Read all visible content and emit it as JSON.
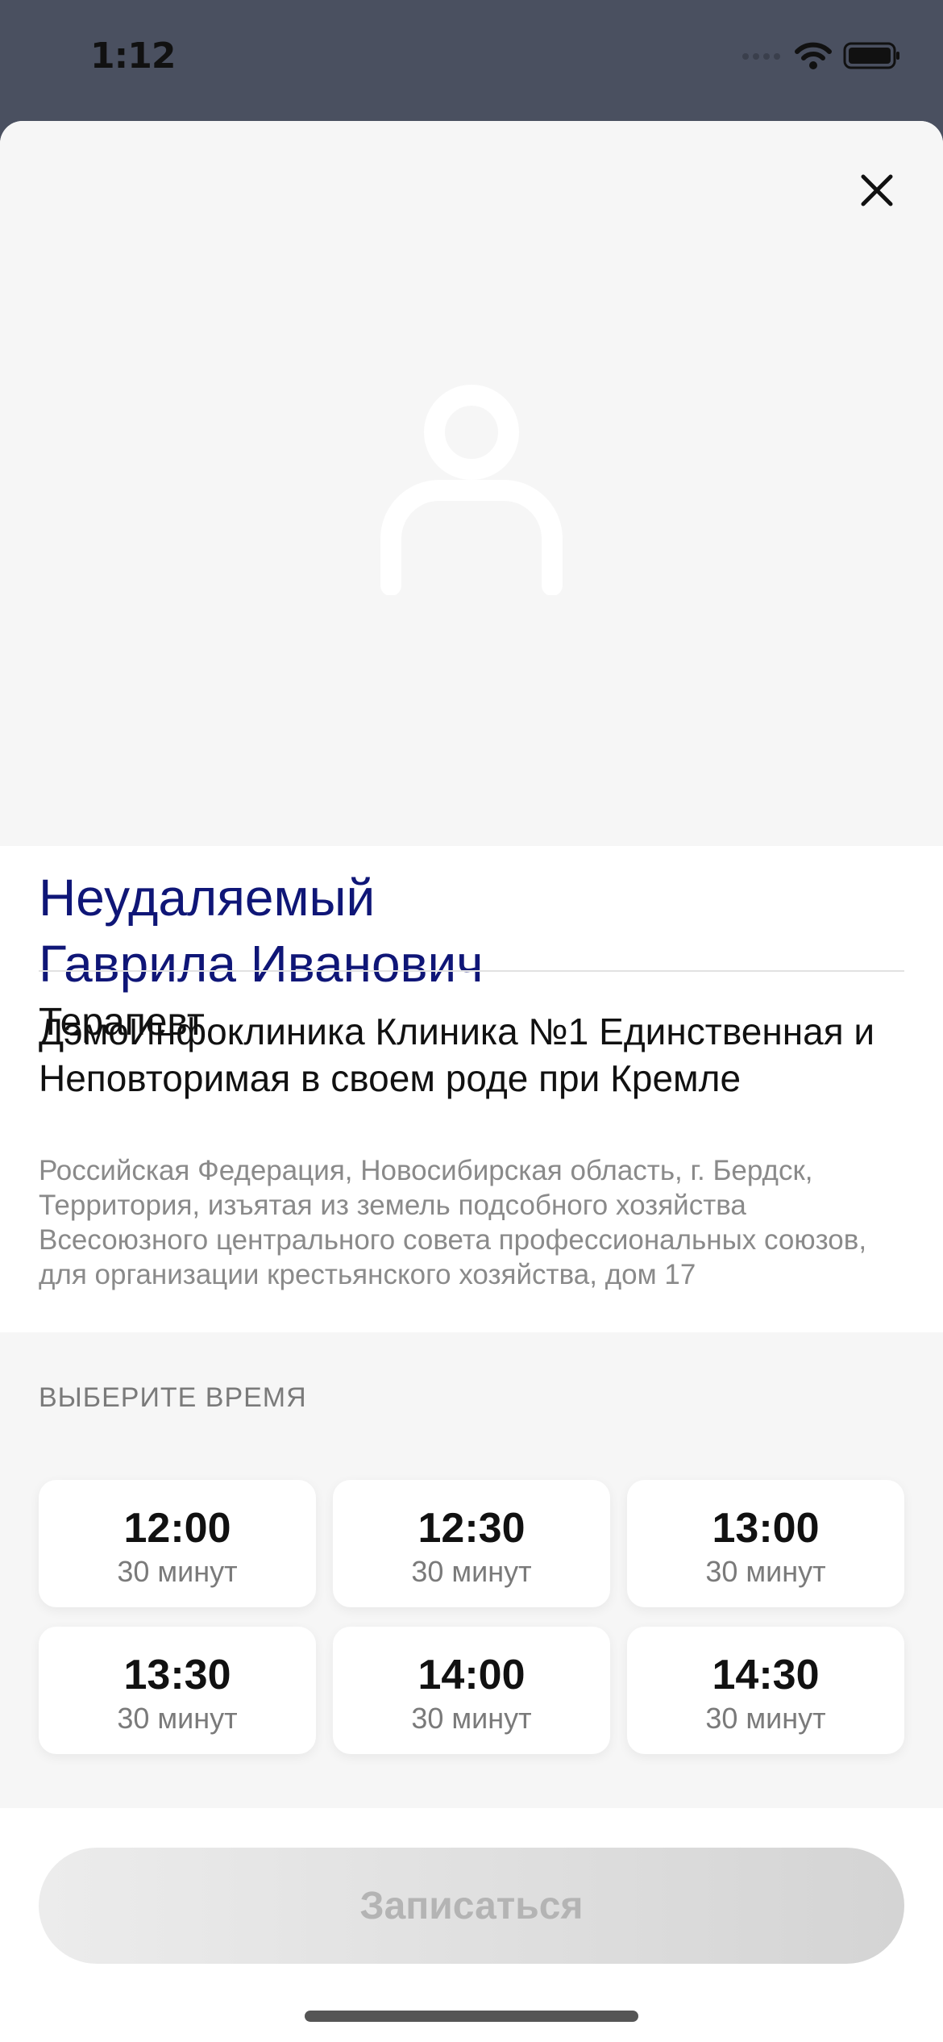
{
  "status_bar": {
    "time": "1:12",
    "icons": [
      "cellular-icon",
      "wifi-icon",
      "battery-icon"
    ]
  },
  "doctor": {
    "last_name": "Неудаляемый",
    "first_name": "Гаврила Иванович",
    "specialty": "Терапевт"
  },
  "clinic": {
    "name": "ДэмоИнфоклиника Клиника №1 Единственная и Неповторимая в своем роде при Кремле",
    "address": "Российская Федерация, Новосибирская область, г. Бердск, Территория, изъятая из земель подсобного хозяйства Всесоюзного центрального совета профессиональных союзов, для организации крестьянского хозяйства, дом 17"
  },
  "time_section": {
    "header": "ВЫБЕРИТЕ ВРЕМЯ",
    "slots": [
      {
        "time": "12:00",
        "duration": "30 минут"
      },
      {
        "time": "12:30",
        "duration": "30 минут"
      },
      {
        "time": "13:00",
        "duration": "30 минут"
      },
      {
        "time": "13:30",
        "duration": "30 минут"
      },
      {
        "time": "14:00",
        "duration": "30 минут"
      },
      {
        "time": "14:30",
        "duration": "30 минут"
      }
    ]
  },
  "actions": {
    "book_label": "Записаться"
  },
  "colors": {
    "name": "#0f1677",
    "status_bar_bg": "#4a5060",
    "photo_bg": "#f6f6f6"
  }
}
